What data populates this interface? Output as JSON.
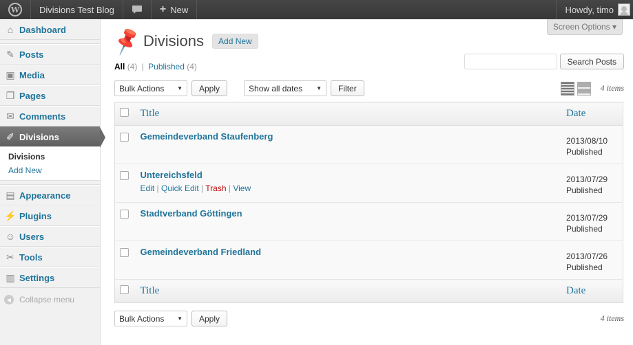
{
  "adminbar": {
    "wp_logo": "W",
    "site_name": "Divisions Test Blog",
    "comments_icon": "comment-icon",
    "new_label": "New",
    "howdy": "Howdy, timo"
  },
  "sidebar": {
    "items": [
      {
        "label": "Dashboard",
        "icon": "⌂"
      },
      {
        "label": "Posts",
        "icon": "✎"
      },
      {
        "label": "Media",
        "icon": "▣"
      },
      {
        "label": "Pages",
        "icon": "❐"
      },
      {
        "label": "Comments",
        "icon": "✉"
      },
      {
        "label": "Divisions",
        "icon": "✐"
      },
      {
        "label": "Appearance",
        "icon": "▤"
      },
      {
        "label": "Plugins",
        "icon": "⚡"
      },
      {
        "label": "Users",
        "icon": "☺"
      },
      {
        "label": "Tools",
        "icon": "✂"
      },
      {
        "label": "Settings",
        "icon": "▥"
      }
    ],
    "submenu": [
      "Divisions",
      "Add New"
    ],
    "collapse": "Collapse menu"
  },
  "main": {
    "screen_options": "Screen Options ▾",
    "title": "Divisions",
    "add_new": "Add New",
    "filters": {
      "all": "All",
      "all_count": "(4)",
      "sep": "|",
      "published": "Published",
      "published_count": "(4)"
    },
    "search": {
      "placeholder": "",
      "button": "Search Posts"
    },
    "bulk_actions": "Bulk Actions",
    "apply": "Apply",
    "dates": "Show all dates",
    "filter": "Filter",
    "items_count": "4 items",
    "columns": {
      "title": "Title",
      "date": "Date"
    },
    "rows": [
      {
        "title": "Gemeindeverband Staufenberg",
        "date": "2013/08/10",
        "status": "Published"
      },
      {
        "title": "Untereichsfeld",
        "date": "2013/07/29",
        "status": "Published"
      },
      {
        "title": "Stadtverband Göttingen",
        "date": "2013/07/29",
        "status": "Published"
      },
      {
        "title": "Gemeindeverband Friedland",
        "date": "2013/07/26",
        "status": "Published"
      }
    ],
    "row_actions": {
      "edit": "Edit",
      "quick_edit": "Quick Edit",
      "trash": "Trash",
      "view": "View",
      "sep": "|"
    }
  }
}
